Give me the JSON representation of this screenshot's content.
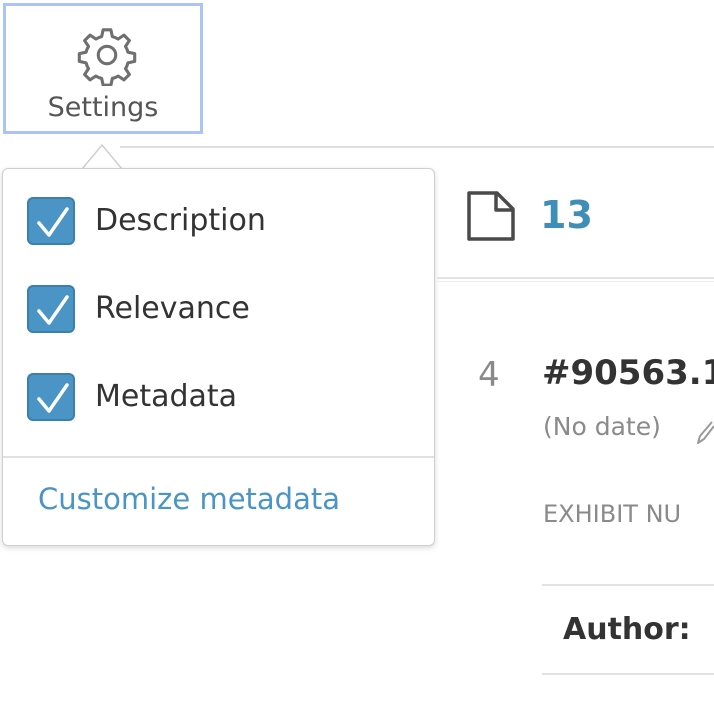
{
  "settings": {
    "label": "Settings",
    "icon": "gear-icon",
    "focus_color": "#a9c4f5"
  },
  "popover": {
    "options": [
      {
        "label": "Description",
        "checked": true
      },
      {
        "label": "Relevance",
        "checked": true
      },
      {
        "label": "Metadata",
        "checked": true
      }
    ],
    "customize_link": "Customize metadata",
    "accent_color": "#4a95c6"
  },
  "header": {
    "doc_icon": "document-icon",
    "count": "13"
  },
  "entry": {
    "number": "4",
    "exhibit_id": "#90563.1",
    "date": "(No date)",
    "exhibit_label": "EXHIBIT NU",
    "author_label": "Author:"
  }
}
